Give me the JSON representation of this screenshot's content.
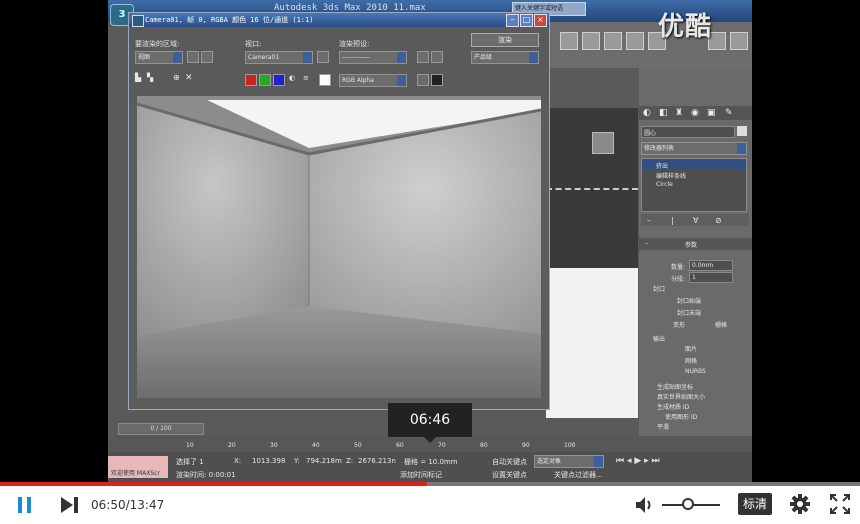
{
  "video": {
    "app_title": "Autodesk 3ds Max  2010    11.max",
    "help_search": "键入关键字或短语",
    "watermark": "优酷",
    "render_window": {
      "title": "Camera01, 帧 0, RGBA 颜色 16 位/通道 (1:1)",
      "area_label": "要渲染的区域:",
      "area_value": "视图",
      "viewport_label": "视口:",
      "viewport_value": "Camera01",
      "preset_label": "渲染预设:",
      "preset_value": "-------------",
      "render_button": "渲染",
      "product_value": "产品级",
      "channel_value": "RGB Alpha"
    },
    "command_panel": {
      "object_name": "圆心",
      "modifier_list": "修改器列表",
      "stack": [
        "挤出",
        "编辑样条线",
        "Circle"
      ],
      "rollout_title": "参数",
      "amount_label": "数量:",
      "amount_value": "0.0mm",
      "segments_label": "分段:",
      "segments_value": "1",
      "capping_label": "封口",
      "cap_start": "封口始端",
      "cap_end": "封口末端",
      "morph": "变形",
      "grid": "栅格",
      "output_label": "输出",
      "out_patch": "面片",
      "out_mesh": "网格",
      "out_nurbs": "NURBS",
      "opt1": "生成贴图坐标",
      "opt2": "真实世界贴图大小",
      "opt3": "生成材质 ID",
      "opt4": "使用图形 ID",
      "opt5": "平滑"
    },
    "timeline": {
      "frame_counter": "0 / 100",
      "ticks": [
        "0",
        "10",
        "20",
        "30",
        "40",
        "50",
        "60",
        "70",
        "80",
        "90",
        "100"
      ]
    },
    "status": {
      "welcome": "欢迎使用 MAXScr",
      "selected": "选择了 1",
      "render_time": "渲染时间: 0:00:01",
      "x_label": "X:",
      "x_value": "1013.398",
      "y_label": "Y:",
      "y_value": "794.218m",
      "z_label": "Z:",
      "z_value": "2676.213n",
      "grid_label": "栅格 = 10.0mm",
      "add_time_tag": "添加时间标记",
      "auto_key": "自动关键点",
      "set_key": "设置关键点",
      "selected_obj": "选定对象",
      "key_filter": "关键点过滤器..."
    }
  },
  "player": {
    "current_time": "06:50",
    "total_time": "13:47",
    "hover_time": "06:46",
    "quality": "标清",
    "progress": 0.496,
    "volume": 0.45
  }
}
